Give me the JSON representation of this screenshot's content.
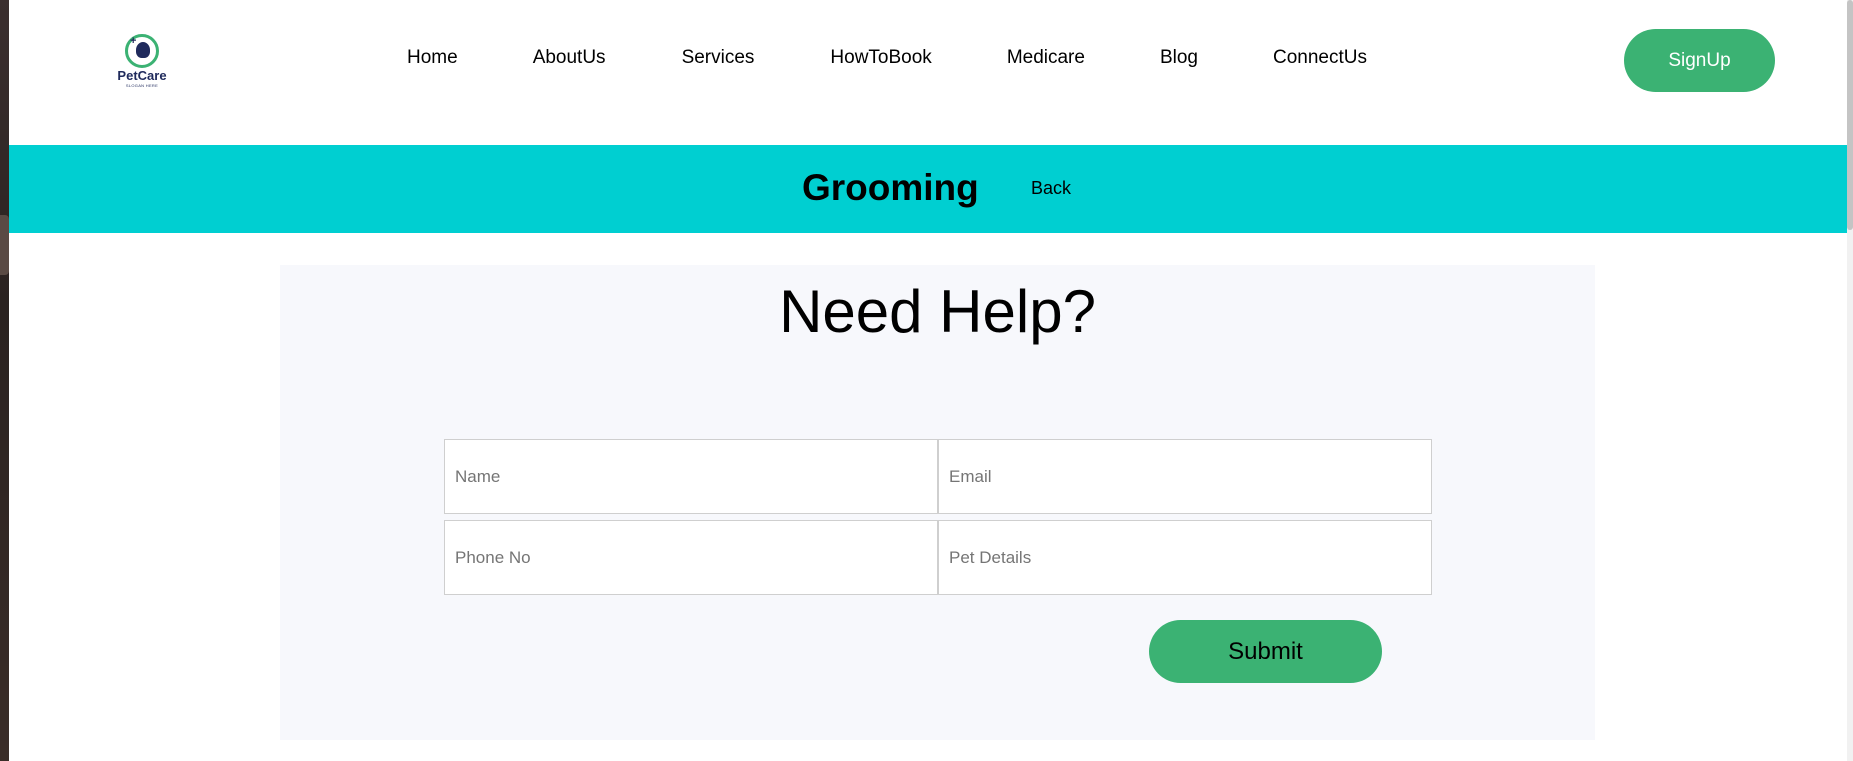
{
  "header": {
    "logo": {
      "brand": "PetCare",
      "tagline": "SLOGAN HERE"
    },
    "nav": [
      {
        "label": "Home"
      },
      {
        "label": "AboutUs"
      },
      {
        "label": "Services"
      },
      {
        "label": "HowToBook"
      },
      {
        "label": "Medicare"
      },
      {
        "label": "Blog"
      },
      {
        "label": "ConnectUs"
      }
    ],
    "signup_label": "SignUp"
  },
  "banner": {
    "title": "Grooming",
    "back_label": "Back"
  },
  "help": {
    "heading": "Need Help?",
    "fields": {
      "name_placeholder": "Name",
      "email_placeholder": "Email",
      "phone_placeholder": "Phone No",
      "pet_placeholder": "Pet Details"
    },
    "submit_label": "Submit"
  },
  "colors": {
    "accent_green": "#3bb273",
    "banner_cyan": "#00cfd1",
    "panel_bg": "#f7f8fc"
  }
}
